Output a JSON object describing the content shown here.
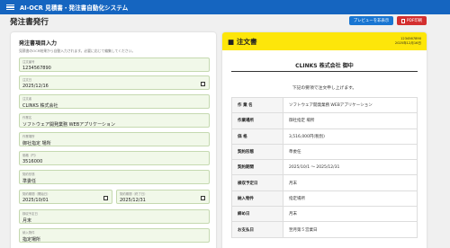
{
  "app": {
    "title": "AI-OCR 見積書・発注書自動化システム"
  },
  "page": {
    "title": "発注書発行"
  },
  "toolbar": {
    "preview_label": "プレビューを非表示",
    "pdf_label": "PDF印刷"
  },
  "form": {
    "title": "発注書項目入力",
    "hint": "見積書のOCR結果から自動入力されます。必要に応じて編集してください。",
    "fields": {
      "order_no": {
        "label": "注文番号",
        "value": "1234567890"
      },
      "order_date": {
        "label": "注文日",
        "value": "2025/12/16"
      },
      "client": {
        "label": "注文者",
        "value": "CLINKS 株式会社"
      },
      "work_name": {
        "label": "作業名",
        "value": "ソフトウェア開発業務 WEBアプリケーション"
      },
      "work_place": {
        "label": "作業場所",
        "value": "御社指定 場所"
      },
      "amount": {
        "label": "価格（円）",
        "value": "3516000"
      },
      "contract": {
        "label": "契約形態",
        "value": "準委任"
      },
      "start": {
        "label": "契約期間（開始日）",
        "value": "2025/10/01"
      },
      "end": {
        "label": "契約期間（終了日）",
        "value": "2025/12/31"
      },
      "inspection": {
        "label": "検収予定日",
        "value": "月末"
      },
      "deliverable": {
        "label": "納入物件",
        "value": "指定場所"
      }
    }
  },
  "preview": {
    "doc_title": "■ 注文書",
    "doc_no": "1234567890",
    "doc_date": "2025年12月16日",
    "recipient": "CLINKS 株式会社 御中",
    "intro": "下記の要項で注文申し上げます。",
    "rows": [
      {
        "key": "作 業 名",
        "value": "ソフトウェア開発業務 WEBアプリケーション"
      },
      {
        "key": "作業場所",
        "value": "御社指定 場所"
      },
      {
        "key": "価 格",
        "value": "3,516,000円(税別)"
      },
      {
        "key": "契約形態",
        "value": "準委任"
      },
      {
        "key": "契約期間",
        "value": "2025/10/1 ～ 2025/12/31"
      },
      {
        "key": "検収予定日",
        "value": "月末"
      },
      {
        "key": "納入物件",
        "value": "指定場所"
      },
      {
        "key": "締め日",
        "value": "月末"
      },
      {
        "key": "お支払日",
        "value": "翌月第５営業日"
      }
    ]
  },
  "colors": {
    "topbar": "#1565c0",
    "preview_button": "#1976d2",
    "pdf_button": "#d32f2f",
    "doc_header": "#fde60a",
    "field_bg": "#f1f8e9"
  }
}
